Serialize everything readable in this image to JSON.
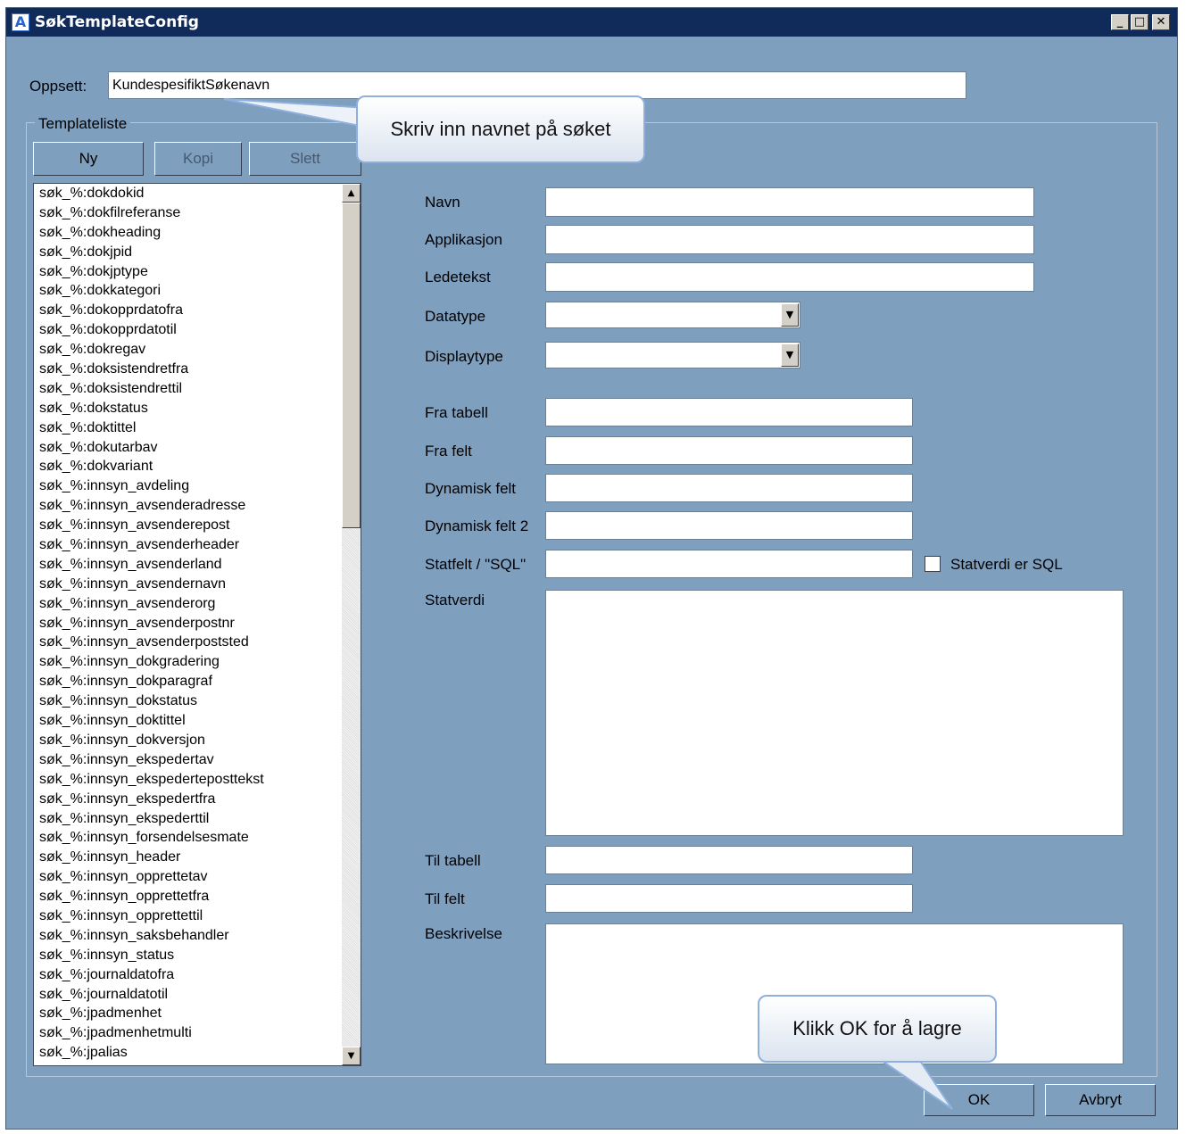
{
  "window": {
    "title": "SøkTemplateConfig",
    "app_icon": "A",
    "controls": [
      "_",
      "□",
      "✕"
    ]
  },
  "oppsett": {
    "label": "Oppsett:",
    "value": "KundespesifiktSøkenavn"
  },
  "templateliste": {
    "group_label": "Templateliste",
    "buttons": {
      "new": "Ny",
      "copy": "Kopi",
      "delete": "Slett"
    },
    "items": [
      "søk_%:dokdokid",
      "søk_%:dokfilreferanse",
      "søk_%:dokheading",
      "søk_%:dokjpid",
      "søk_%:dokjptype",
      "søk_%:dokkategori",
      "søk_%:dokopprdatofra",
      "søk_%:dokopprdatotil",
      "søk_%:dokregav",
      "søk_%:doksistendretfra",
      "søk_%:doksistendrettil",
      "søk_%:dokstatus",
      "søk_%:doktittel",
      "søk_%:dokutarbav",
      "søk_%:dokvariant",
      "søk_%:innsyn_avdeling",
      "søk_%:innsyn_avsenderadresse",
      "søk_%:innsyn_avsenderepost",
      "søk_%:innsyn_avsenderheader",
      "søk_%:innsyn_avsenderland",
      "søk_%:innsyn_avsendernavn",
      "søk_%:innsyn_avsenderorg",
      "søk_%:innsyn_avsenderpostnr",
      "søk_%:innsyn_avsenderpoststed",
      "søk_%:innsyn_dokgradering",
      "søk_%:innsyn_dokparagraf",
      "søk_%:innsyn_dokstatus",
      "søk_%:innsyn_doktittel",
      "søk_%:innsyn_dokversjon",
      "søk_%:innsyn_ekspedertav",
      "søk_%:innsyn_ekspederteposttekst",
      "søk_%:innsyn_ekspedertfra",
      "søk_%:innsyn_ekspederttil",
      "søk_%:innsyn_forsendelsesmate",
      "søk_%:innsyn_header",
      "søk_%:innsyn_opprettetav",
      "søk_%:innsyn_opprettetfra",
      "søk_%:innsyn_opprettettil",
      "søk_%:innsyn_saksbehandler",
      "søk_%:innsyn_status",
      "søk_%:journaldatofra",
      "søk_%:journaldatotil",
      "søk_%:jpadmenhet",
      "søk_%:jpadmenhetmulti",
      "søk_%:jpalias"
    ]
  },
  "form": {
    "navn": {
      "label": "Navn",
      "value": ""
    },
    "applikasjon": {
      "label": "Applikasjon",
      "value": ""
    },
    "ledetekst": {
      "label": "Ledetekst",
      "value": ""
    },
    "datatype": {
      "label": "Datatype",
      "value": ""
    },
    "displaytype": {
      "label": "Displaytype",
      "value": ""
    },
    "fra_tabell": {
      "label": "Fra tabell",
      "value": ""
    },
    "fra_felt": {
      "label": "Fra felt",
      "value": ""
    },
    "dynamisk_felt": {
      "label": "Dynamisk felt",
      "value": ""
    },
    "dynamisk_felt_2": {
      "label": "Dynamisk felt 2",
      "value": ""
    },
    "statfelt": {
      "label": "Statfelt / \"SQL\"",
      "value": ""
    },
    "statverdi_er_sql": {
      "label": "Statverdi er SQL",
      "checked": false
    },
    "statverdi": {
      "label": "Statverdi",
      "value": ""
    },
    "til_tabell": {
      "label": "Til tabell",
      "value": ""
    },
    "til_felt": {
      "label": "Til felt",
      "value": ""
    },
    "beskrivelse": {
      "label": "Beskrivelse",
      "value": ""
    }
  },
  "footer": {
    "ok": "OK",
    "cancel": "Avbryt"
  },
  "callouts": {
    "name_hint": "Skriv inn navnet på søket",
    "ok_hint": "Klikk OK for å lagre"
  }
}
